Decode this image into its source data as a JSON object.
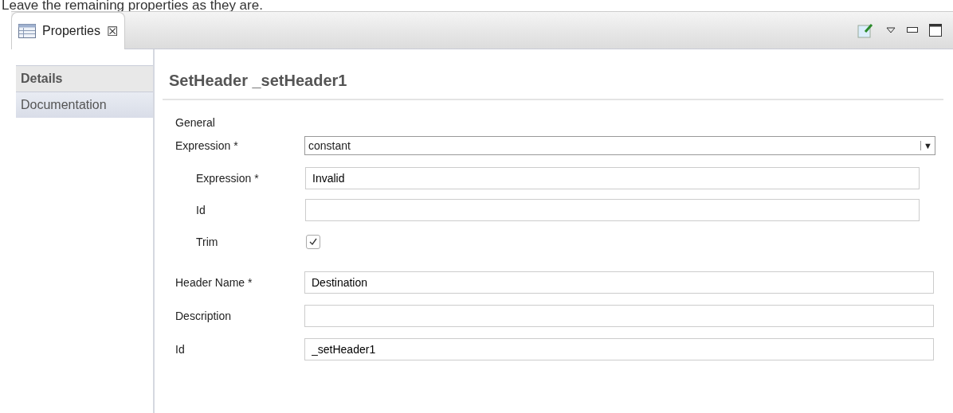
{
  "intro_text": "Leave the remaining properties as they are.",
  "view_tab": {
    "label": "Properties",
    "close": "☒",
    "selected": true
  },
  "sidebar": {
    "items": [
      {
        "label": "Details",
        "selected": true
      },
      {
        "label": "Documentation",
        "selected": false
      }
    ]
  },
  "title": "SetHeader _setHeader1",
  "section_label": "General",
  "expression": {
    "label": "Expression *",
    "value": "constant",
    "arrow": "▼"
  },
  "sub_fields": [
    {
      "kind": "text",
      "label": "Expression *",
      "value": "Invalid"
    },
    {
      "kind": "text",
      "label": "Id"
    },
    {
      "kind": "checkbox",
      "label": "Trim",
      "checked": true
    }
  ],
  "fields": [
    {
      "label": "Header Name *",
      "value": "Destination"
    },
    {
      "label": "Description"
    },
    {
      "label": "Id",
      "value": "_setHeader1"
    }
  ]
}
